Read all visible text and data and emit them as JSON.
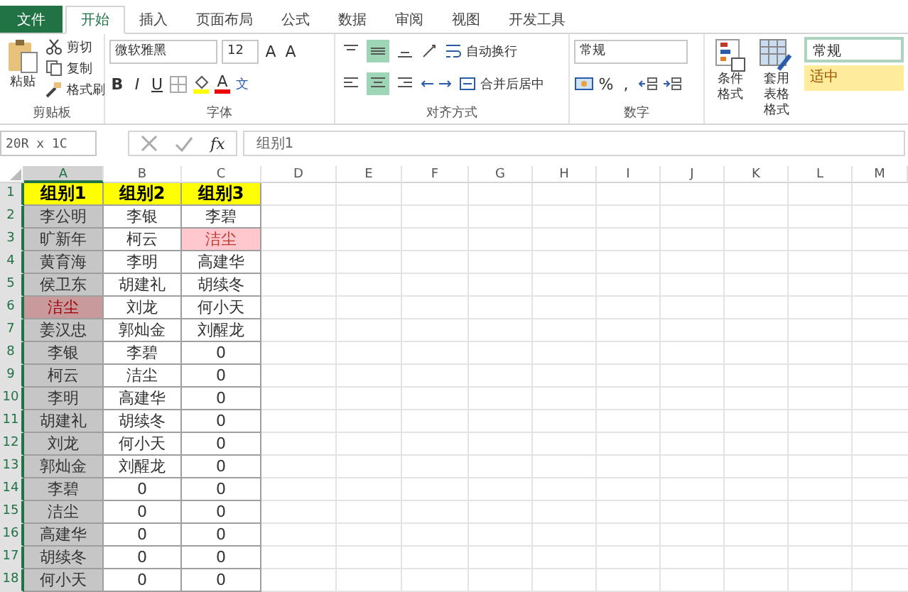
{
  "tabs": [
    {
      "label": "文件",
      "kind": "file",
      "selected": false
    },
    {
      "label": "开始",
      "kind": "tab",
      "selected": true
    },
    {
      "label": "插入",
      "kind": "tab",
      "selected": false
    },
    {
      "label": "页面布局",
      "kind": "tab",
      "selected": false
    },
    {
      "label": "公式",
      "kind": "tab",
      "selected": false
    },
    {
      "label": "数据",
      "kind": "tab",
      "selected": false
    },
    {
      "label": "审阅",
      "kind": "tab",
      "selected": false
    },
    {
      "label": "视图",
      "kind": "tab",
      "selected": false
    },
    {
      "label": "开发工具",
      "kind": "tab",
      "selected": false
    }
  ],
  "clipboard": {
    "paste": "粘贴",
    "cut": "剪切",
    "copy": "复制",
    "format_painter": "格式刷",
    "label": "剪贴板"
  },
  "font": {
    "family": "微软雅黑",
    "size": "12",
    "grow": "A",
    "shrink": "A",
    "bold": "B",
    "italic": "I",
    "underline": "U",
    "color_letter": "A",
    "phonetic": "文",
    "label": "字体"
  },
  "alignment": {
    "valign": [
      {
        "selected": false
      },
      {
        "selected": true
      },
      {
        "selected": false
      }
    ],
    "halign": [
      {
        "selected": false
      },
      {
        "selected": true
      },
      {
        "selected": false
      }
    ],
    "wrap": "自动换行",
    "merge": "合并后居中",
    "label": "对齐方式"
  },
  "number": {
    "format": "常规",
    "percent": "%",
    "comma": ",",
    "label": "数字"
  },
  "styles": {
    "conditional": "条件格式",
    "table_format_1": "套用",
    "table_format_2": "表格格式",
    "style_normal": "常规",
    "style_neutral": "适中"
  },
  "formula_bar": {
    "name_box": "20R x 1C",
    "fx": "fx",
    "value": "组别1"
  },
  "columns": [
    {
      "label": "A",
      "selected": true
    },
    {
      "label": "B",
      "selected": false
    },
    {
      "label": "C",
      "selected": false
    },
    {
      "label": "D",
      "selected": false
    },
    {
      "label": "E",
      "selected": false
    },
    {
      "label": "F",
      "selected": false
    },
    {
      "label": "G",
      "selected": false
    },
    {
      "label": "H",
      "selected": false
    },
    {
      "label": "I",
      "selected": false
    },
    {
      "label": "J",
      "selected": false
    },
    {
      "label": "K",
      "selected": false
    },
    {
      "label": "L",
      "selected": false
    },
    {
      "label": "M",
      "selected": false
    }
  ],
  "rows": [
    {
      "number": "1",
      "kind": "header",
      "cells": [
        {
          "text": "组别1",
          "highlight": false
        },
        {
          "text": "组别2",
          "highlight": false
        },
        {
          "text": "组别3",
          "highlight": false
        }
      ]
    },
    {
      "number": "2",
      "kind": "data",
      "cells": [
        {
          "text": "李公明",
          "highlight": false
        },
        {
          "text": "李银",
          "highlight": false
        },
        {
          "text": "李碧",
          "highlight": false
        }
      ]
    },
    {
      "number": "3",
      "kind": "data",
      "cells": [
        {
          "text": "旷新年",
          "highlight": false
        },
        {
          "text": "柯云",
          "highlight": false
        },
        {
          "text": "洁尘",
          "highlight": true
        }
      ]
    },
    {
      "number": "4",
      "kind": "data",
      "cells": [
        {
          "text": "黄育海",
          "highlight": false
        },
        {
          "text": "李明",
          "highlight": false
        },
        {
          "text": "高建华",
          "highlight": false
        }
      ]
    },
    {
      "number": "5",
      "kind": "data",
      "cells": [
        {
          "text": "侯卫东",
          "highlight": false
        },
        {
          "text": "胡建礼",
          "highlight": false
        },
        {
          "text": "胡续冬",
          "highlight": false
        }
      ]
    },
    {
      "number": "6",
      "kind": "data",
      "cells": [
        {
          "text": "洁尘",
          "highlight": true
        },
        {
          "text": "刘龙",
          "highlight": false
        },
        {
          "text": "何小天",
          "highlight": false
        }
      ]
    },
    {
      "number": "7",
      "kind": "data",
      "cells": [
        {
          "text": "姜汉忠",
          "highlight": false
        },
        {
          "text": "郭灿金",
          "highlight": false
        },
        {
          "text": "刘醒龙",
          "highlight": false
        }
      ]
    },
    {
      "number": "8",
      "kind": "data",
      "cells": [
        {
          "text": "李银",
          "highlight": false
        },
        {
          "text": "李碧",
          "highlight": false
        },
        {
          "text": "0",
          "highlight": false
        }
      ]
    },
    {
      "number": "9",
      "kind": "data",
      "cells": [
        {
          "text": "柯云",
          "highlight": false
        },
        {
          "text": "洁尘",
          "highlight": false
        },
        {
          "text": "0",
          "highlight": false
        }
      ]
    },
    {
      "number": "10",
      "kind": "data",
      "cells": [
        {
          "text": "李明",
          "highlight": false
        },
        {
          "text": "高建华",
          "highlight": false
        },
        {
          "text": "0",
          "highlight": false
        }
      ]
    },
    {
      "number": "11",
      "kind": "data",
      "cells": [
        {
          "text": "胡建礼",
          "highlight": false
        },
        {
          "text": "胡续冬",
          "highlight": false
        },
        {
          "text": "0",
          "highlight": false
        }
      ]
    },
    {
      "number": "12",
      "kind": "data",
      "cells": [
        {
          "text": "刘龙",
          "highlight": false
        },
        {
          "text": "何小天",
          "highlight": false
        },
        {
          "text": "0",
          "highlight": false
        }
      ]
    },
    {
      "number": "13",
      "kind": "data",
      "cells": [
        {
          "text": "郭灿金",
          "highlight": false
        },
        {
          "text": "刘醒龙",
          "highlight": false
        },
        {
          "text": "0",
          "highlight": false
        }
      ]
    },
    {
      "number": "14",
      "kind": "data",
      "cells": [
        {
          "text": "李碧",
          "highlight": false
        },
        {
          "text": "0",
          "highlight": false
        },
        {
          "text": "0",
          "highlight": false
        }
      ]
    },
    {
      "number": "15",
      "kind": "data",
      "cells": [
        {
          "text": "洁尘",
          "highlight": false
        },
        {
          "text": "0",
          "highlight": false
        },
        {
          "text": "0",
          "highlight": false
        }
      ]
    },
    {
      "number": "16",
      "kind": "data",
      "cells": [
        {
          "text": "高建华",
          "highlight": false
        },
        {
          "text": "0",
          "highlight": false
        },
        {
          "text": "0",
          "highlight": false
        }
      ]
    },
    {
      "number": "17",
      "kind": "data",
      "cells": [
        {
          "text": "胡续冬",
          "highlight": false
        },
        {
          "text": "0",
          "highlight": false
        },
        {
          "text": "0",
          "highlight": false
        }
      ]
    },
    {
      "number": "18",
      "kind": "data",
      "cells": [
        {
          "text": "何小天",
          "highlight": false
        },
        {
          "text": "0",
          "highlight": false
        },
        {
          "text": "0",
          "highlight": false
        }
      ]
    }
  ]
}
